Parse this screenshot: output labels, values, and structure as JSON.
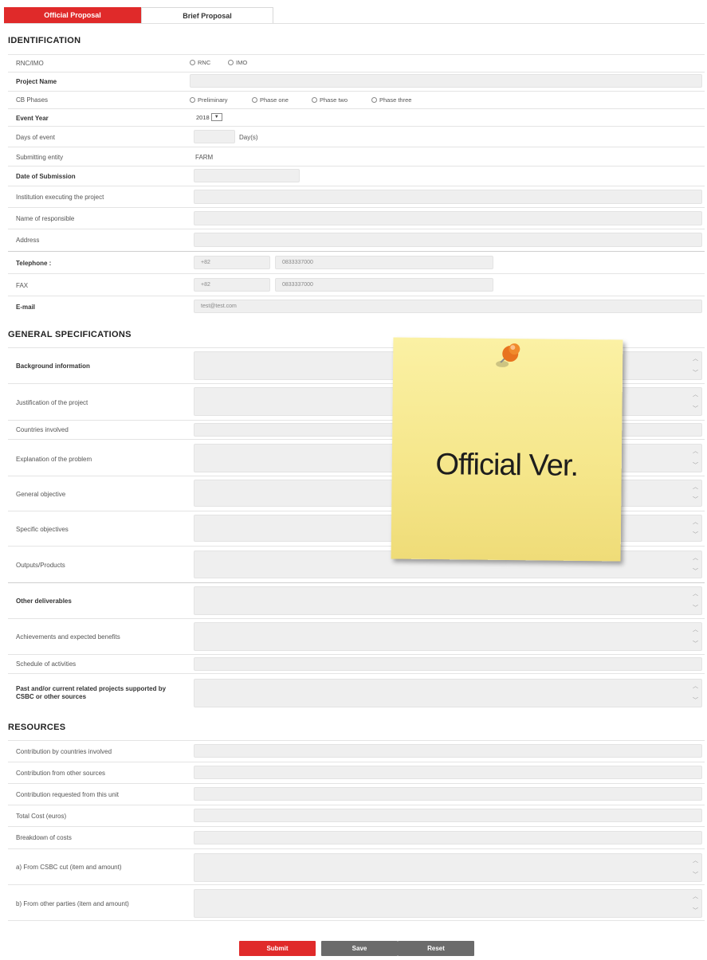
{
  "tabs": [
    {
      "label": "Official Proposal",
      "active": true
    },
    {
      "label": "Brief Proposal",
      "active": false
    }
  ],
  "identification": {
    "title": "IDENTIFICATION",
    "rows": {
      "rnc": {
        "label": "RNC/IMO",
        "options": [
          "RNC",
          "IMO"
        ]
      },
      "project_name": {
        "label": "Project Name"
      },
      "phases": {
        "label": "CB Phases",
        "options": [
          "Preliminary",
          "Phase one",
          "Phase two",
          "Phase three"
        ]
      },
      "event_year": {
        "label": "Event Year",
        "value": "2018"
      },
      "days": {
        "label": "Days of event",
        "unit": "Day(s)"
      },
      "submitting_entity": {
        "label": "Submitting entity",
        "value": "FARM"
      },
      "date_submission": {
        "label": "Date of Submission"
      },
      "institution": {
        "label": "Institution executing the project"
      },
      "responsible": {
        "label": "Name of responsible"
      },
      "address": {
        "label": "Address"
      },
      "telephone": {
        "label": "Telephone :",
        "code": "+82",
        "number": "0833337000"
      },
      "fax": {
        "label": "FAX",
        "code": "+82",
        "number": "0833337000"
      },
      "email": {
        "label": "E-mail",
        "value": "test@test.com"
      }
    }
  },
  "general": {
    "title": "GENERAL SPECIFICATIONS",
    "rows": [
      {
        "label": "Background information",
        "bold": true
      },
      {
        "label": "Justification of the project"
      },
      {
        "label": "Countries involved"
      },
      {
        "label": "Explanation of the problem"
      },
      {
        "label": "General objective"
      },
      {
        "label": "Specific objectives"
      },
      {
        "label": "Outputs/Products"
      },
      {
        "label": "Other deliverables",
        "bold": true
      },
      {
        "label": "Achievements and expected benefits"
      },
      {
        "label": "Schedule of activities"
      },
      {
        "label": "Past and/or current related projects supported by CSBC or other sources",
        "bold": true
      }
    ]
  },
  "resources": {
    "title": "RESOURCES",
    "rows": [
      {
        "label": "Contribution by countries involved"
      },
      {
        "label": "Contribution from other sources"
      },
      {
        "label": "Contribution requested from this unit"
      },
      {
        "label": "Total Cost (euros)"
      },
      {
        "label": "Breakdown of costs"
      },
      {
        "label": "a) From CSBC cut (item and amount)"
      },
      {
        "label": "b) From other parties (item and amount)"
      }
    ]
  },
  "buttons": {
    "submit": "Submit",
    "save": "Save",
    "reset": "Reset"
  },
  "sticky_note": {
    "text": "Official Ver."
  },
  "colors": {
    "accent": "#e02a2a",
    "button_gray": "#6b6b6b",
    "note": "#f5e68a"
  }
}
